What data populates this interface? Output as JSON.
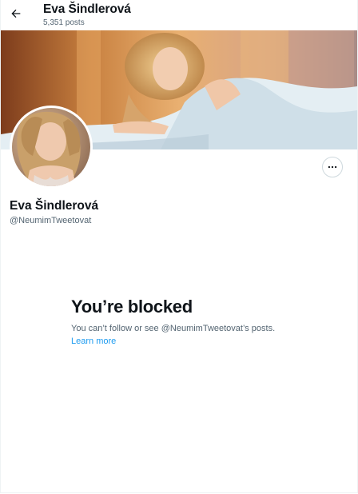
{
  "header": {
    "back_icon": "arrow-left-icon",
    "title": "Eva Šindlerová",
    "post_count": "5,351 posts"
  },
  "profile": {
    "display_name": "Eva Šindlerová",
    "handle": "@NeumimTweetovat",
    "more_icon": "ellipsis-icon"
  },
  "blocked_notice": {
    "title": "You’re blocked",
    "description": "You can’t follow or see @NeumimTweetovat’s posts.",
    "link": "Learn more"
  },
  "colors": {
    "text_primary": "#0f1419",
    "text_secondary": "#536471",
    "link": "#1d9bf0",
    "border": "#cfd9de"
  }
}
